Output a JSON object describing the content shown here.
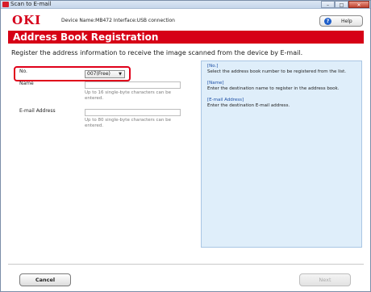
{
  "window": {
    "title": "Scan to E-mail",
    "controls": {
      "minimize": "–",
      "maximize": "□",
      "close": "✕"
    }
  },
  "header": {
    "logo": "OKI",
    "device_info": "Device Name:MB472  Interface:USB connection",
    "help_label": "Help",
    "help_icon": "?"
  },
  "page": {
    "title": "Address Book Registration",
    "instruction": "Register the address information to receive the image scanned from the device by E-mail."
  },
  "form": {
    "no_label": "No.",
    "no_value": "007(Free)",
    "name_label": "Name",
    "name_value": "",
    "name_hint": "Up to 16 single-byte characters can be entered.",
    "email_label": "E-mail Address",
    "email_value": "",
    "email_hint": "Up to 80 single-byte characters can be entered."
  },
  "help_panel": {
    "no_title": "[No.]",
    "no_text": "Select the address book number to be registered from the list.",
    "name_title": "[Name]",
    "name_text": "Enter the destination name to register in the address book.",
    "email_title": "[E-mail Address]",
    "email_text": "Enter the destination E-mail address."
  },
  "footer": {
    "cancel_label": "Cancel",
    "next_label": "Next"
  },
  "colors": {
    "brand_red": "#d6001c",
    "panel_bg": "#dfeefa",
    "highlight": "#e0001a"
  }
}
